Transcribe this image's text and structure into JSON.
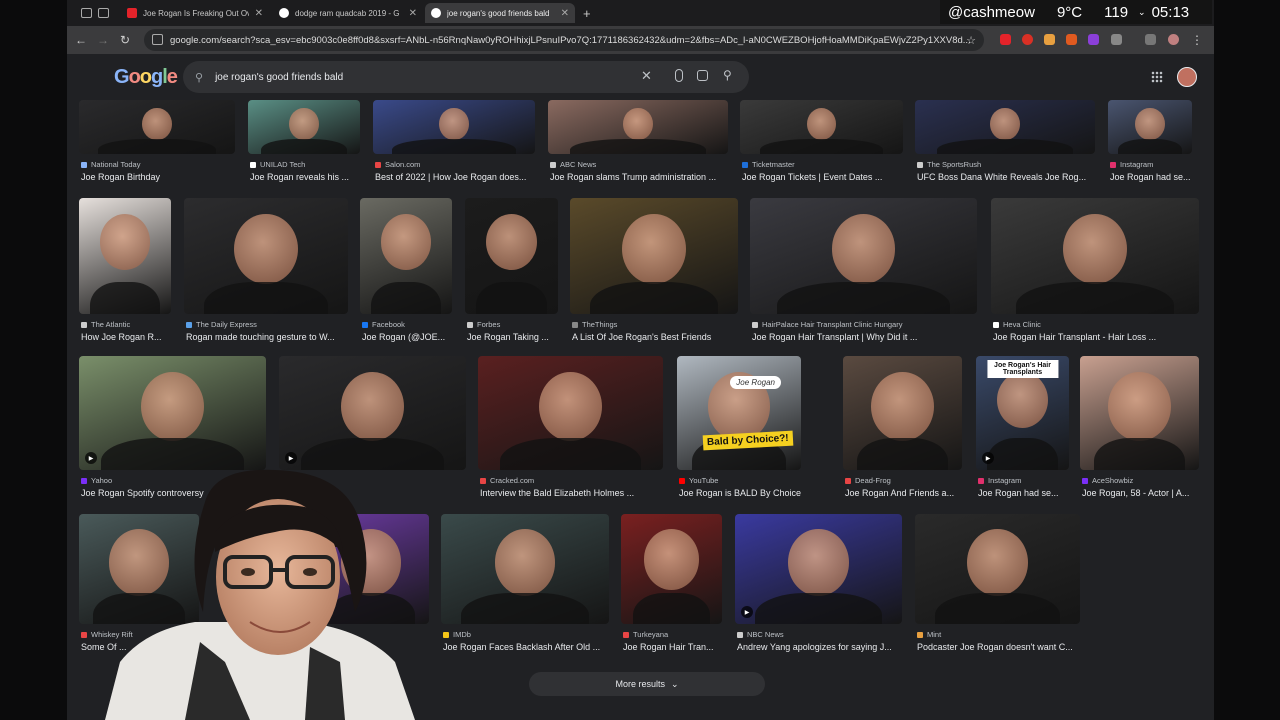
{
  "tabs": [
    {
      "title": "Joe Rogan Is Freaking Out Ov",
      "color": "#e4232a"
    },
    {
      "title": "dodge ram quadcab 2019 - G",
      "color": "#8ab4f8"
    },
    {
      "title": "joe rogan's good friends bald",
      "color": "#8ab4f8"
    }
  ],
  "overlay": {
    "handle": "@cashmeow",
    "temp": "9°C",
    "count": "119",
    "time": "05:13"
  },
  "address": {
    "url": "google.com/search?sca_esv=ebc9003c0e8ff0d8&sxsrf=ANbL-n56RnqNaw0yROHhixjLPsnuIPvo7Q:1771186362432&udm=2&fbs=ADc_l-aN0CWEZBOHjofHoaMMDiKpaEWjvZ2Py1XXV8d..."
  },
  "google": {
    "logo": "Google",
    "query": "joe rogan's good friends bald"
  },
  "results": [
    {
      "src": "National Today",
      "title": "Joe Rogan Birthday",
      "tone": "#2a2a2c",
      "dot": "#8ab4f8"
    },
    {
      "src": "UNILAD Tech",
      "title": "Joe Rogan reveals his ...",
      "tone": "#5a8f85",
      "dot": "#ffffff"
    },
    {
      "src": "Salon.com",
      "title": "Best of 2022 | How Joe Rogan does...",
      "tone": "#3a4a8a",
      "dot": "#e84545"
    },
    {
      "src": "ABC News",
      "title": "Joe Rogan slams Trump administration ...",
      "tone": "#8a6a60",
      "dot": "#cccccc"
    },
    {
      "src": "Ticketmaster",
      "title": "Joe Rogan Tickets | Event Dates ...",
      "tone": "#3a3a3a",
      "dot": "#1e6fd9"
    },
    {
      "src": "The SportsRush",
      "title": "UFC Boss Dana White Reveals Joe Rog...",
      "tone": "#2a3050",
      "dot": "#cccccc"
    },
    {
      "src": "Instagram",
      "title": "Joe Rogan had se...",
      "tone": "#4a5570",
      "dot": "#e1306c"
    },
    {
      "src": "The Atlantic",
      "title": "How Joe Rogan R...",
      "tone": "#e6e0dc",
      "dot": "#cccccc"
    },
    {
      "src": "The Daily Express",
      "title": "Rogan made touching gesture to W...",
      "tone": "#2c2c2e",
      "dot": "#5aa0e8"
    },
    {
      "src": "Facebook",
      "title": "Joe Rogan (@JOE...",
      "tone": "#6a6a62",
      "dot": "#1877f2"
    },
    {
      "src": "Forbes",
      "title": "Joe Rogan Taking ...",
      "tone": "#1c1c1c",
      "dot": "#cccccc"
    },
    {
      "src": "TheThings",
      "title": "A List Of Joe Rogan's Best Friends",
      "tone": "#5a4a2a",
      "dot": "#888888"
    },
    {
      "src": "HairPalace Hair Transplant Clinic Hungary",
      "title": "Joe Rogan Hair Transplant | Why Did it ...",
      "tone": "#3a3a40",
      "dot": "#cccccc"
    },
    {
      "src": "Heva Clinic",
      "title": "Joe Rogan Hair Transplant - Hair Loss ...",
      "tone": "#3a3a3a",
      "dot": "#ffffff"
    },
    {
      "src": "Yahoo",
      "title": "Joe Rogan Spotify controversy",
      "tone": "#7a8f6a",
      "dot": "#7b2ff7"
    },
    {
      "src": "",
      "title": "...urder ...",
      "tone": "#2a2a2c",
      "dot": "#888888"
    },
    {
      "src": "Cracked.com",
      "title": "Interview the Bald Elizabeth Holmes ...",
      "tone": "#5a2020",
      "dot": "#e84545"
    },
    {
      "src": "YouTube",
      "title": "Joe Rogan is BALD By Choice ...",
      "tone": "#b0b8c0",
      "dot": "#ff0000",
      "caption": "Bald by Choice?!",
      "tag": "Joe Rogan"
    },
    {
      "src": "Dead-Frog",
      "title": "Joe Rogan And Friends a...",
      "tone": "#5a4a40",
      "dot": "#e84545"
    },
    {
      "src": "Instagram",
      "title": "Joe Rogan had se...",
      "tone": "#3a4a6a",
      "dot": "#e1306c",
      "caption": "Joe Rogan's Hair Transplants"
    },
    {
      "src": "AceShowbiz",
      "title": "Joe Rogan, 58 - Actor | A...",
      "tone": "#c8a090",
      "dot": "#7b2ff7"
    },
    {
      "src": "Whiskey Rift",
      "title": "Some Of ...",
      "tone": "#4a5a5a",
      "dot": "#e84545"
    },
    {
      "src": "",
      "title": "...o ...",
      "tone": "#6a3aa0",
      "dot": "#888888"
    },
    {
      "src": "IMDb",
      "title": "Joe Rogan Faces Backlash After Old ...",
      "tone": "#3a4a4a",
      "dot": "#f5c518"
    },
    {
      "src": "Turkeyana",
      "title": "Joe Rogan Hair Tran...",
      "tone": "#7a2020",
      "dot": "#e84545"
    },
    {
      "src": "NBC News",
      "title": "Andrew Yang apologizes for saying J...",
      "tone": "#3a3aa0",
      "dot": "#cccccc"
    },
    {
      "src": "Mint",
      "title": "Podcaster Joe Rogan doesn't want C...",
      "tone": "#2a2a2a",
      "dot": "#e8a040"
    }
  ],
  "more_results": "More results",
  "colors": {
    "bg": "#202124",
    "search": "#303134",
    "accent": "#8ab4f8"
  }
}
